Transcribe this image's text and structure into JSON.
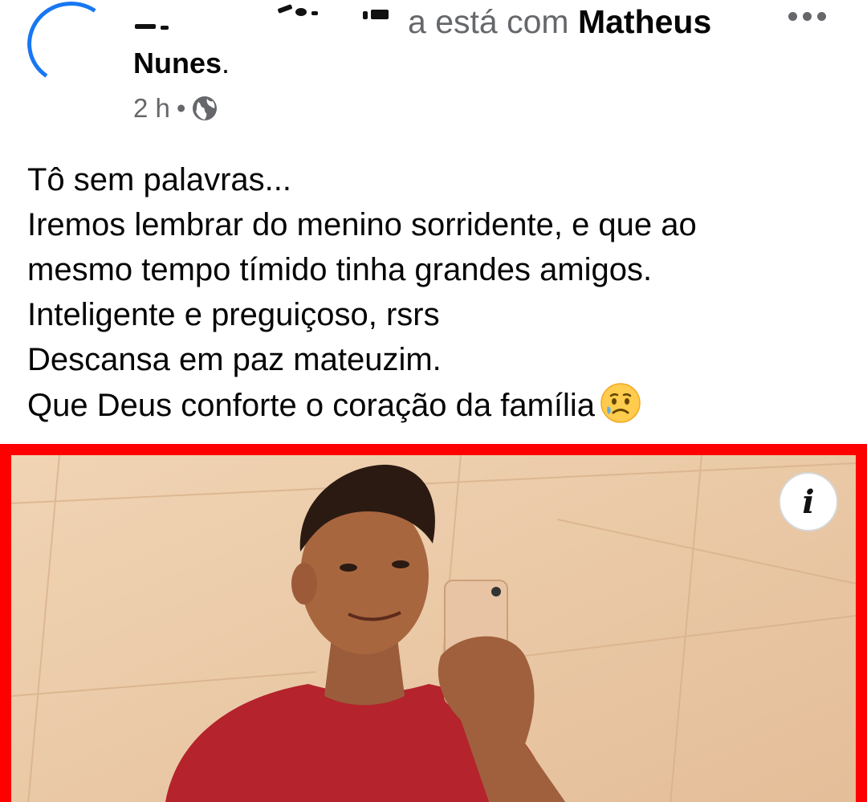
{
  "post": {
    "author_visible_fragment": "a",
    "with_text": "está com",
    "tagged_name_line1": "Matheus",
    "tagged_name_line2": "Nunes",
    "tagged_suffix": ".",
    "time": "2 h",
    "separator": "•",
    "audience_icon": "globe-icon",
    "more_icon": "more-options-icon",
    "lines": [
      "Tô sem palavras...",
      "Iremos lembrar do menino sorridente, e que ao",
      "mesmo tempo tímido tinha grandes amigos.",
      "Inteligente e preguiçoso, rsrs",
      "Descansa em paz mateuzim.",
      "Que Deus conforte o coração da família"
    ],
    "final_emoji": "sad-but-relieved-face-icon"
  },
  "photo": {
    "border_color": "#ff0000",
    "info_label": "i"
  },
  "colors": {
    "accent": "#1877f2",
    "secondary_text": "#65676b",
    "primary_text": "#050505"
  }
}
